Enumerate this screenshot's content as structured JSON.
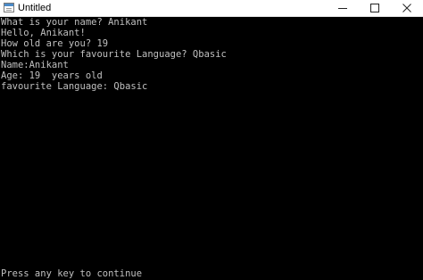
{
  "window": {
    "title": "Untitled",
    "icon": "console-window-icon",
    "controls": {
      "minimize_icon": "minimize-icon",
      "maximize_icon": "maximize-icon",
      "close_icon": "close-icon"
    }
  },
  "console": {
    "background": "#000000",
    "text_color": "#c0c0c0",
    "lines": [
      "What is your name? Anikant",
      "Hello, Anikant!",
      "How old are you? 19",
      "Which is your favourite Language? Qbasic",
      "Name:Anikant",
      "Age: 19  years old",
      "favourite Language: Qbasic"
    ],
    "prompt": "Press any key to continue"
  }
}
